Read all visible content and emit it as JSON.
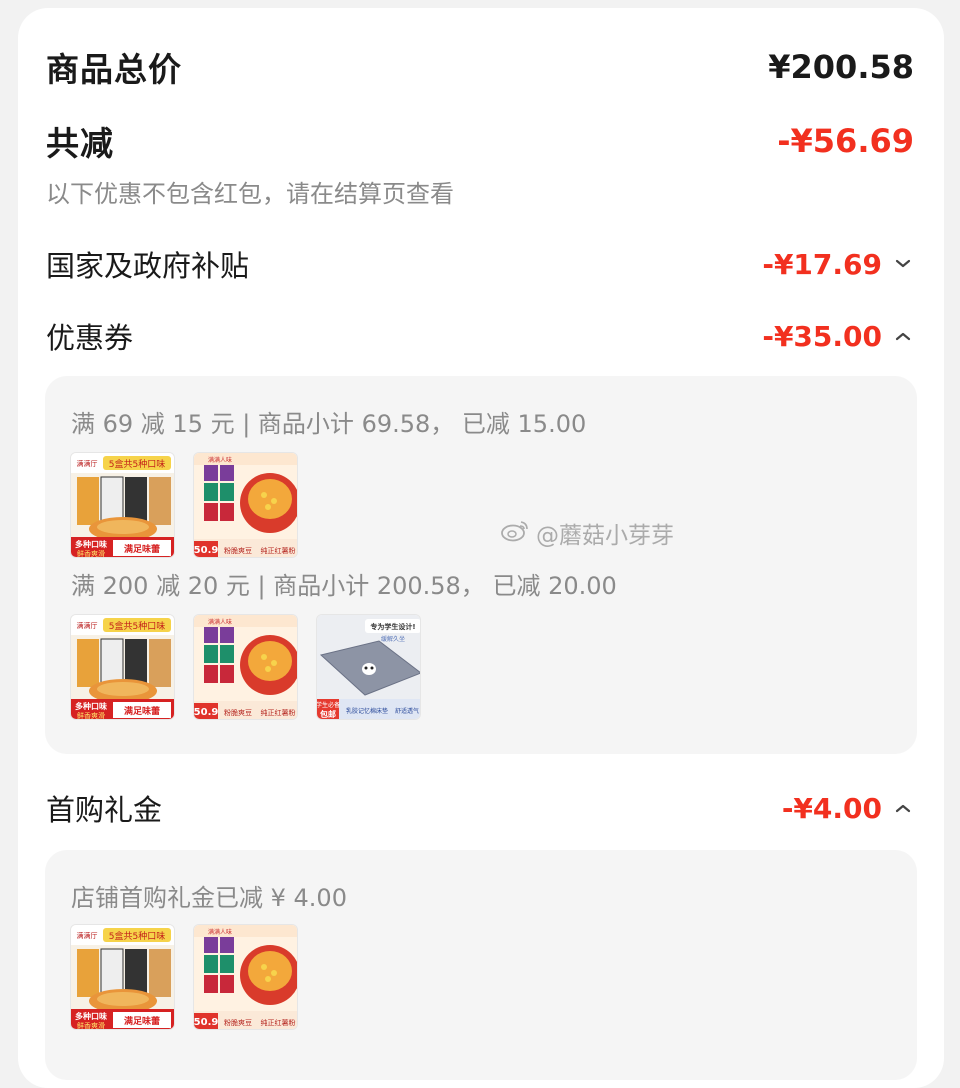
{
  "summary": {
    "total_label": "商品总价",
    "total_value": "¥200.58",
    "reduce_label": "共减",
    "reduce_value": "-¥56.69",
    "note": "以下优惠不包含红包，请在结算页查看"
  },
  "subsidy": {
    "label": "国家及政府补贴",
    "value": "-¥17.69"
  },
  "coupon": {
    "label": "优惠券",
    "value": "-¥35.00",
    "rules": [
      {
        "text": "满 69 减 15 元 | 商品小计 69.58，  已减 15.00"
      },
      {
        "text": "满 200 减 20 元 | 商品小计 200.58，  已减 20.00"
      }
    ]
  },
  "first_gift": {
    "label": "首购礼金",
    "value": "-¥4.00",
    "rule": "店铺首购礼金已减 ¥ 4.00"
  },
  "products": {
    "noodle": {
      "badge": "5盒共5种口味",
      "brand": "满满厅",
      "tag1": "多种口味",
      "tag2": "鲜香爽滑",
      "tag3": "满足味蕾"
    },
    "instant": {
      "brand": "满满人味",
      "price": "50.9",
      "tag1": "粉脆爽豆",
      "tag2": "纯正红薯粉"
    },
    "cushion": {
      "head": "专为学生设计!",
      "tag": "包邮",
      "tag_top": "学生必备",
      "tag_mid": "缓解久坐",
      "note": "乳胶记忆棉床垫",
      "tag3": "舒适透气"
    }
  },
  "watermark": {
    "text": "@蘑菇小芽芽"
  },
  "colors": {
    "accent": "#f2301f",
    "muted": "#8a8a8a",
    "panel": "#f5f5f5"
  },
  "icons": {
    "collapse": "chevron-down-icon",
    "expand": "chevron-up-icon"
  }
}
